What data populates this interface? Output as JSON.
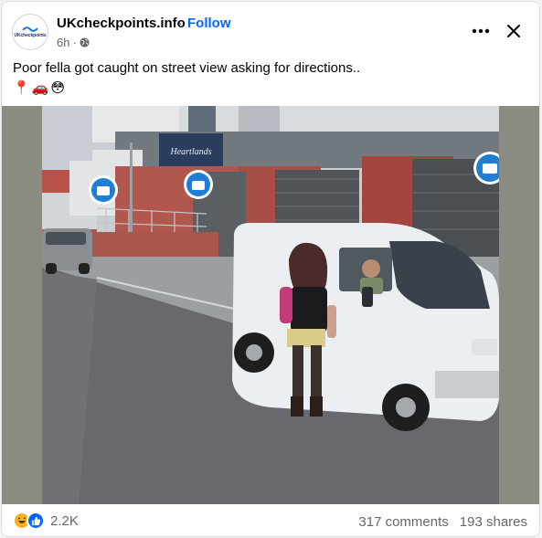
{
  "post": {
    "page_name": "UKcheckpoints.info",
    "separator": "·",
    "follow_label": "Follow",
    "time": "6h",
    "time_separator": "·",
    "avatar_logo_text": "UKcheckpoints",
    "caption": "Poor fella got caught on street view asking for directions..",
    "caption_emojis": [
      "📍",
      "🚗",
      "😳"
    ]
  },
  "photo": {
    "shop_sign": "Heartlands"
  },
  "footer": {
    "reaction_count": "2.2K",
    "comments": "317 comments",
    "shares": "193 shares"
  },
  "icons": {
    "header": [
      "more-options-icon",
      "close-icon",
      "globe-icon"
    ],
    "reactions": [
      "haha-reaction-icon",
      "like-reaction-icon"
    ]
  },
  "colors": {
    "follow_blue": "#0866ff",
    "secondary_text": "#65676b",
    "haha_yellow": "#f7b125",
    "like_blue": "#0866ff"
  }
}
